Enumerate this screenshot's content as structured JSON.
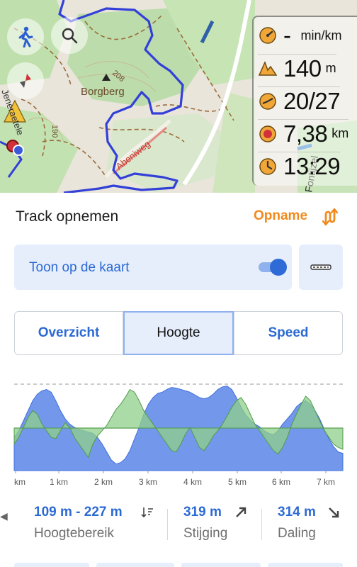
{
  "map": {
    "labels": {
      "peak_name": "Borgberg",
      "elevation_mark": "208",
      "road_name": "Abeniweg",
      "left_road": "Jeneraetele",
      "left_number": "190",
      "right_road": "Fontijzel"
    },
    "buttons": {
      "walk_icon": "walking-person-icon",
      "search_icon": "search-icon",
      "compass_icon": "compass-icon"
    },
    "widgets": [
      {
        "icon": "speedometer-icon",
        "value": "-",
        "unit": "min/km"
      },
      {
        "icon": "altitude-icon",
        "value": "140",
        "unit": "m"
      },
      {
        "icon": "cadence-icon",
        "value": "20/27",
        "unit": ""
      },
      {
        "icon": "distance-icon",
        "value": "7,38",
        "unit": "km"
      },
      {
        "icon": "clock-icon",
        "value": "13:29",
        "unit": ""
      }
    ]
  },
  "sheet": {
    "title": "Track opnemen",
    "action_label": "Opname",
    "toggle": {
      "label": "Toon op de kaart",
      "on": true
    },
    "tabs": [
      {
        "label": "Overzicht",
        "active": false
      },
      {
        "label": "Hoogte",
        "active": true
      },
      {
        "label": "Speed",
        "active": false
      }
    ]
  },
  "chart_data": {
    "type": "area",
    "x_unit": "km",
    "x_ticks": [
      "km",
      "1 km",
      "2 km",
      "3 km",
      "4 km",
      "5 km",
      "6 km",
      "7 km"
    ],
    "series": [
      {
        "values": [
          150,
          160,
          175,
          190,
          205,
          215,
          220,
          222,
          218,
          205,
          190,
          178,
          170,
          165,
          162,
          160,
          158,
          156,
          150,
          140,
          128,
          116,
          110,
          112,
          118,
          130,
          148,
          165,
          185,
          200,
          210,
          216,
          218,
          222,
          225,
          224,
          222,
          220,
          218,
          214,
          210,
          208,
          210,
          215,
          222,
          226,
          227,
          222,
          210,
          196,
          184,
          176,
          170,
          166,
          160,
          156,
          154,
          160,
          170,
          178,
          186,
          196,
          202,
          205,
          200,
          190,
          178,
          162,
          148,
          136,
          128,
          126
        ]
      },
      {
        "values": [
          140,
          150,
          165,
          180,
          190,
          185,
          170,
          160,
          150,
          148,
          160,
          172,
          165,
          150,
          140,
          130,
          120,
          140,
          152,
          160,
          168,
          180,
          192,
          200,
          210,
          222,
          218,
          205,
          190,
          180,
          170,
          160,
          150,
          140,
          130,
          128,
          140,
          155,
          165,
          150,
          135,
          130,
          140,
          152,
          160,
          170,
          182,
          195,
          205,
          210,
          200,
          185,
          170,
          160,
          150,
          140,
          130,
          125,
          135,
          150,
          170,
          185,
          200,
          212,
          205,
          190,
          175,
          160,
          150,
          140,
          135,
          132
        ]
      }
    ],
    "colors": {
      "elevation": "#5a86e8",
      "slope": "#8fd08a",
      "dashed_grid": "#9a9a9a"
    }
  },
  "stats": [
    {
      "value": "109 m - 227 m",
      "label": "Hoogtebereik",
      "icon": "range-sort-icon"
    },
    {
      "value": "319 m",
      "label": "Stijging",
      "icon": "arrow-up-right-icon"
    },
    {
      "value": "314 m",
      "label": "Daling",
      "icon": "arrow-down-right-icon"
    }
  ],
  "colors": {
    "accent": "#2c6ad3",
    "action": "#f08a1c",
    "track": "#3340d8",
    "map_green": "#bcdcab"
  }
}
